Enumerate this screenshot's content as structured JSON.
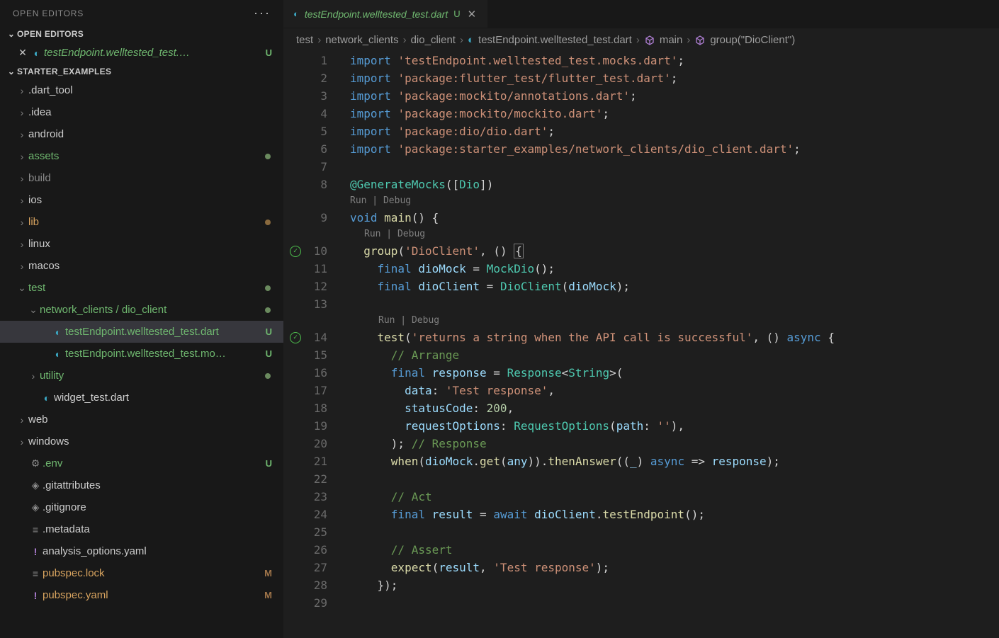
{
  "sidebar": {
    "title": "OPEN EDITORS",
    "sections": {
      "openEditors": {
        "label": "OPEN EDITORS",
        "items": [
          {
            "label": "testEndpoint.welltested_test.…",
            "badge": "U"
          }
        ]
      },
      "project": {
        "label": "STARTER_EXAMPLES",
        "items": [
          {
            "label": ".dart_tool",
            "type": "folder",
            "chev": ">",
            "depth": 1
          },
          {
            "label": ".idea",
            "type": "folder",
            "chev": ">",
            "depth": 1
          },
          {
            "label": "android",
            "type": "folder",
            "chev": ">",
            "depth": 1
          },
          {
            "label": "assets",
            "type": "folder",
            "chev": ">",
            "depth": 1,
            "color": "green",
            "dot": "green-dot"
          },
          {
            "label": "build",
            "type": "folder",
            "chev": ">",
            "depth": 1,
            "color": "gray"
          },
          {
            "label": "ios",
            "type": "folder",
            "chev": ">",
            "depth": 1
          },
          {
            "label": "lib",
            "type": "folder",
            "chev": ">",
            "depth": 1,
            "color": "orange",
            "dot": "orange-dot"
          },
          {
            "label": "linux",
            "type": "folder",
            "chev": ">",
            "depth": 1
          },
          {
            "label": "macos",
            "type": "folder",
            "chev": ">",
            "depth": 1
          },
          {
            "label": "test",
            "type": "folder",
            "chev": "v",
            "depth": 1,
            "color": "green",
            "dot": "green-dot"
          },
          {
            "label": "network_clients / dio_client",
            "type": "folder",
            "chev": "v",
            "depth": 2,
            "color": "green",
            "dot": "green-dot"
          },
          {
            "label": "testEndpoint.welltested_test.dart",
            "type": "file",
            "depth": 3,
            "color": "green",
            "badge": "U",
            "icon": "dart",
            "selected": true
          },
          {
            "label": "testEndpoint.welltested_test.mo…",
            "type": "file",
            "depth": 3,
            "color": "green",
            "badge": "U",
            "icon": "dart"
          },
          {
            "label": "utility",
            "type": "folder",
            "chev": ">",
            "depth": 2,
            "color": "green",
            "dot": "green-dot"
          },
          {
            "label": "widget_test.dart",
            "type": "file",
            "depth": 2,
            "icon": "dart"
          },
          {
            "label": "web",
            "type": "folder",
            "chev": ">",
            "depth": 1
          },
          {
            "label": "windows",
            "type": "folder",
            "chev": ">",
            "depth": 1
          },
          {
            "label": ".env",
            "type": "file",
            "depth": 1,
            "color": "green",
            "badge": "U",
            "icon": "gear"
          },
          {
            "label": ".gitattributes",
            "type": "file",
            "depth": 1,
            "icon": "diamond"
          },
          {
            "label": ".gitignore",
            "type": "file",
            "depth": 1,
            "icon": "diamond"
          },
          {
            "label": ".metadata",
            "type": "file",
            "depth": 1,
            "icon": "lines"
          },
          {
            "label": "analysis_options.yaml",
            "type": "file",
            "depth": 1,
            "icon": "bang",
            "color": "white"
          },
          {
            "label": "pubspec.lock",
            "type": "file",
            "depth": 1,
            "color": "orange",
            "badge": "M",
            "icon": "lines"
          },
          {
            "label": "pubspec.yaml",
            "type": "file",
            "depth": 1,
            "color": "orange",
            "badge": "M",
            "icon": "bang"
          }
        ]
      }
    }
  },
  "tab": {
    "label": "testEndpoint.welltested_test.dart",
    "badge": "U"
  },
  "breadcrumb": [
    {
      "label": "test"
    },
    {
      "label": "network_clients"
    },
    {
      "label": "dio_client"
    },
    {
      "label": "testEndpoint.welltested_test.dart",
      "icon": "dart"
    },
    {
      "label": "main",
      "icon": "cube"
    },
    {
      "label": "group(\"DioClient\")",
      "icon": "cube"
    }
  ],
  "codelens": {
    "runDebug": "Run | Debug"
  },
  "code": {
    "lines": [
      {
        "n": 1,
        "html": "<span class='kw'>import</span> <span class='str'>'testEndpoint.welltested_test.mocks.dart'</span>;"
      },
      {
        "n": 2,
        "html": "<span class='kw'>import</span> <span class='str'>'package:flutter_test/flutter_test.dart'</span>;"
      },
      {
        "n": 3,
        "html": "<span class='kw'>import</span> <span class='str'>'package:mockito/annotations.dart'</span>;"
      },
      {
        "n": 4,
        "html": "<span class='kw'>import</span> <span class='str'>'package:mockito/mockito.dart'</span>;"
      },
      {
        "n": 5,
        "html": "<span class='kw'>import</span> <span class='str'>'package:dio/dio.dart'</span>;"
      },
      {
        "n": 6,
        "html": "<span class='kw'>import</span> <span class='str'>'package:starter_examples/network_clients/dio_client.dart'</span>;"
      },
      {
        "n": 7,
        "html": ""
      },
      {
        "n": 8,
        "html": "<span class='ann'>@GenerateMocks</span>(<span class='punc'>[</span><span class='cls'>Dio</span><span class='punc'>]</span>)"
      },
      {
        "n": 0,
        "codelens": true,
        "indent": 0
      },
      {
        "n": 9,
        "html": "<span class='kw'>void</span> <span class='fn'>main</span>() {"
      },
      {
        "n": 0,
        "codelens": true,
        "indent": 2
      },
      {
        "n": 10,
        "html": "  <span class='fn'>group</span>(<span class='str'>'DioClient'</span>, () <span class='cursor'>{</span>",
        "pass": true
      },
      {
        "n": 11,
        "html": "    <span class='kw'>final</span> <span class='var'>dioMock</span> = <span class='cls'>MockDio</span>();"
      },
      {
        "n": 12,
        "html": "    <span class='kw'>final</span> <span class='var'>dioClient</span> = <span class='cls'>DioClient</span>(<span class='var'>dioMock</span>);"
      },
      {
        "n": 13,
        "html": ""
      },
      {
        "n": 0,
        "codelens": true,
        "indent": 4
      },
      {
        "n": 14,
        "html": "    <span class='fn'>test</span>(<span class='str'>'returns a string when the API call is successful'</span>, () <span class='kw'>async</span> {",
        "pass": true
      },
      {
        "n": 15,
        "html": "      <span class='cmt'>// Arrange</span>"
      },
      {
        "n": 16,
        "html": "      <span class='kw'>final</span> <span class='var'>response</span> = <span class='cls'>Response</span>&lt;<span class='cls'>String</span>&gt;("
      },
      {
        "n": 17,
        "html": "        <span class='param'>data</span>: <span class='str'>'Test response'</span>,"
      },
      {
        "n": 18,
        "html": "        <span class='param'>statusCode</span>: <span class='num'>200</span>,"
      },
      {
        "n": 19,
        "html": "        <span class='param'>requestOptions</span>: <span class='cls'>RequestOptions</span>(<span class='param'>path</span>: <span class='str'>''</span>),"
      },
      {
        "n": 20,
        "html": "      ); <span class='cmt'>// Response</span>"
      },
      {
        "n": 21,
        "html": "      <span class='fn'>when</span>(<span class='var'>dioMock</span>.<span class='fn'>get</span>(<span class='var'>any</span>)).<span class='fn'>thenAnswer</span>((<span class='var'>_</span>) <span class='kw'>async</span> =&gt; <span class='var'>response</span>);"
      },
      {
        "n": 22,
        "html": ""
      },
      {
        "n": 23,
        "html": "      <span class='cmt'>// Act</span>"
      },
      {
        "n": 24,
        "html": "      <span class='kw'>final</span> <span class='var'>result</span> = <span class='kw'>await</span> <span class='var'>dioClient</span>.<span class='fn'>testEndpoint</span>();"
      },
      {
        "n": 25,
        "html": ""
      },
      {
        "n": 26,
        "html": "      <span class='cmt'>// Assert</span>"
      },
      {
        "n": 27,
        "html": "      <span class='fn'>expect</span>(<span class='var'>result</span>, <span class='str'>'Test response'</span>);"
      },
      {
        "n": 28,
        "html": "    });"
      },
      {
        "n": 29,
        "html": ""
      }
    ]
  }
}
